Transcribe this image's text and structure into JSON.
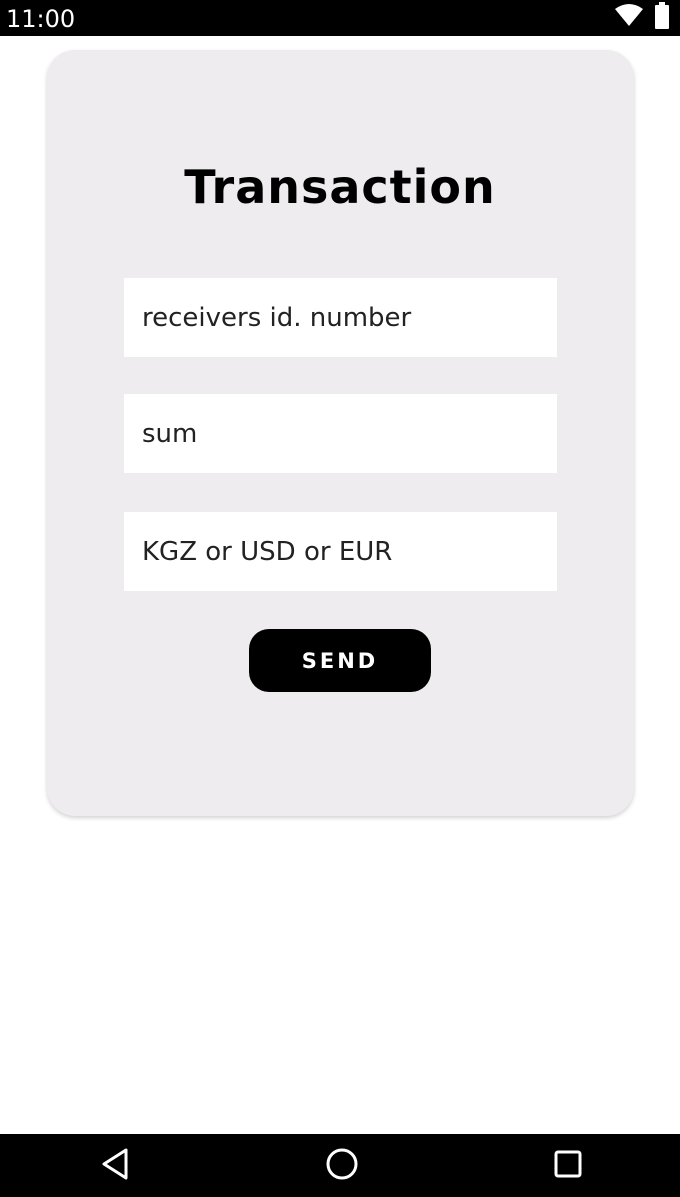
{
  "status_bar": {
    "time": "11:00",
    "icons": [
      "wifi-icon",
      "battery-icon"
    ]
  },
  "transaction_form": {
    "title": "Transaction",
    "receiver_field": {
      "placeholder": "receivers id. number",
      "value": ""
    },
    "sum_field": {
      "placeholder": "sum",
      "value": ""
    },
    "currency_field": {
      "placeholder": "KGZ or USD or EUR",
      "value": ""
    },
    "send_label": "SEND"
  },
  "navigation_bar": {
    "buttons": [
      "back-icon",
      "home-icon",
      "recents-icon"
    ]
  },
  "colors": {
    "card_background": "#eeecee",
    "button_background": "#000000",
    "button_text": "#ffffff",
    "system_bars": "#000000"
  }
}
